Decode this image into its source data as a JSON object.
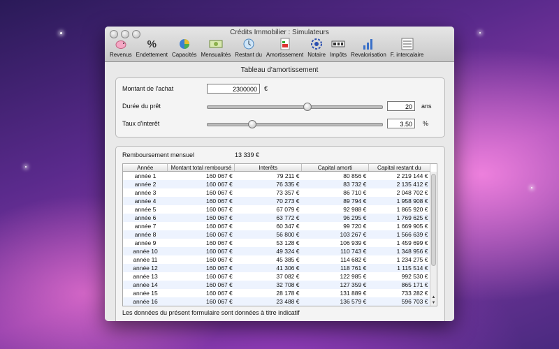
{
  "window": {
    "title": "Crédits Immobilier : Simulateurs"
  },
  "toolbar": [
    {
      "label": "Revenus",
      "icon": "piggy-bank-icon"
    },
    {
      "label": "Endettement",
      "icon": "percent-icon"
    },
    {
      "label": "Capacités",
      "icon": "pie-chart-icon"
    },
    {
      "label": "Mensualités",
      "icon": "banknote-icon"
    },
    {
      "label": "Restant du",
      "icon": "clock-icon"
    },
    {
      "label": "Amortissement",
      "icon": "chart-doc-icon"
    },
    {
      "label": "Notaire",
      "icon": "notary-seal-icon"
    },
    {
      "label": "Impôts",
      "icon": "tax-icon"
    },
    {
      "label": "Revalorisation",
      "icon": "bar-growth-icon"
    },
    {
      "label": "F. intercalaire",
      "icon": "list-doc-icon"
    }
  ],
  "heading": "Tableau d'amortissement",
  "form": {
    "purchase_label": "Montant de l'achat",
    "purchase_value": "2300000",
    "purchase_unit": "€",
    "duration_label": "Durée du prêt",
    "duration_value": "20",
    "duration_unit": "ans",
    "duration_slider_fraction": 0.57,
    "rate_label": "Taux d'interêt",
    "rate_value": "3.50",
    "rate_unit": "%",
    "rate_slider_fraction": 0.24
  },
  "summary": {
    "monthly_label": "Remboursement mensuel",
    "monthly_value": "13 339 €"
  },
  "table": {
    "columns": [
      "Année",
      "Montant total remboursé",
      "Interêts",
      "Capital amorti",
      "Capital restant du"
    ],
    "rows": [
      [
        "année 1",
        "160 067 €",
        "79 211 €",
        "80 856 €",
        "2 219 144 €"
      ],
      [
        "année 2",
        "160 067 €",
        "76 335 €",
        "83 732 €",
        "2 135 412 €"
      ],
      [
        "année 3",
        "160 067 €",
        "73 357 €",
        "86 710 €",
        "2 048 702 €"
      ],
      [
        "année 4",
        "160 067 €",
        "70 273 €",
        "89 794 €",
        "1 958 908 €"
      ],
      [
        "année 5",
        "160 067 €",
        "67 079 €",
        "92 988 €",
        "1 865 920 €"
      ],
      [
        "année 6",
        "160 067 €",
        "63 772 €",
        "96 295 €",
        "1 769 625 €"
      ],
      [
        "année 7",
        "160 067 €",
        "60 347 €",
        "99 720 €",
        "1 669 905 €"
      ],
      [
        "année 8",
        "160 067 €",
        "56 800 €",
        "103 267 €",
        "1 566 639 €"
      ],
      [
        "année 9",
        "160 067 €",
        "53 128 €",
        "106 939 €",
        "1 459 699 €"
      ],
      [
        "année 10",
        "160 067 €",
        "49 324 €",
        "110 743 €",
        "1 348 956 €"
      ],
      [
        "année 11",
        "160 067 €",
        "45 385 €",
        "114 682 €",
        "1 234 275 €"
      ],
      [
        "année 12",
        "160 067 €",
        "41 306 €",
        "118 761 €",
        "1 115 514 €"
      ],
      [
        "année 13",
        "160 067 €",
        "37 082 €",
        "122 985 €",
        "992 530 €"
      ],
      [
        "année 14",
        "160 067 €",
        "32 708 €",
        "127 359 €",
        "865 171 €"
      ],
      [
        "année 15",
        "160 067 €",
        "28 178 €",
        "131 889 €",
        "733 282 €"
      ],
      [
        "année 16",
        "160 067 €",
        "23 488 €",
        "136 579 €",
        "596 703 €"
      ]
    ]
  },
  "footer": "Les données du présent formulaire sont données à titre indicatif"
}
